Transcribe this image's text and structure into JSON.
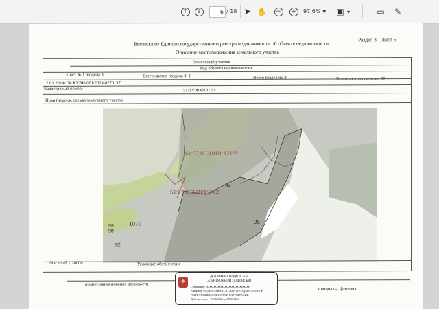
{
  "toolbar": {
    "page_current": "6",
    "page_total": "/ 18",
    "zoom": "97,6%"
  },
  "document": {
    "section_label": "Раздел 3",
    "sheet_label": "Лист 6",
    "title": "Выписка из Единого государственного реестра недвижимости об объекте недвижимости",
    "subtitle": "Описание местоположения земельного участка",
    "object_type": "Земельный участок",
    "object_type_caption": "вид объекта недвижимости",
    "sheet_no": "Лист № 1 раздела 3",
    "sheets_in_section": "Всего листов раздела 3: 1",
    "sections_total": "Всего разделов: 8",
    "sheets_total": "Всего листов выписки: 18",
    "date_number": "12.01.2024г. № КУВИ-001/2024-8270137",
    "cadastral_label": "Кадастровый номер:",
    "cadastral_value": "51:07:0030101:95",
    "plan_label": "План (чертеж, схема) земельного участка",
    "scale": "Масштаб 1:20000",
    "legend": "Условные обозначения",
    "position_caption": "полное наименование должности",
    "initials_caption": "инициалы, фамилия"
  },
  "map": {
    "labels": [
      "51:07:0030101:121/2",
      "51:07:0030101:94/2",
      "94",
      "95",
      "1070",
      "93",
      "98",
      "92",
      "29"
    ]
  },
  "stamp": {
    "line1": "ДОКУМЕНТ ПОДПИСАН",
    "line2": "ЭЛЕКТРОННОЙ ПОДПИСЬЮ",
    "cert": "Сертификат: 00000000000000000000000000000000",
    "owner1": "Владелец: ФЕДЕРАЛЬНАЯ СЛУЖБА ГОСУДАРСТВЕННОЙ",
    "owner2": "РЕГИСТРАЦИИ, КАДАСТРА И КАРТОГРАФИИ",
    "valid": "Действителен: с 27.06.2023 по 19.09.2024"
  }
}
